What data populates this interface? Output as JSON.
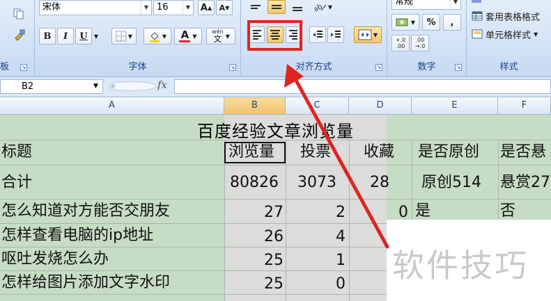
{
  "ribbon": {
    "font_group": {
      "font_name": "宋体",
      "font_size": "16",
      "label": "字体",
      "grow_label": "A",
      "shrink_label": "A",
      "bold": "B",
      "italic": "I",
      "underline": "U",
      "font_color_label": "A",
      "phonetic_label": "wén",
      "phonetic_char": "文"
    },
    "clipboard_group": {
      "label": "板"
    },
    "alignment_group": {
      "label": "对齐方式"
    },
    "number_group": {
      "label": "数字",
      "format_value": "常规",
      "percent": "%",
      "comma": ",",
      "inc_decimal": "+.0 .00",
      "dec_decimal": ".00 →.0"
    },
    "styles_group": {
      "label": "样式",
      "table_format": "套用表格格式",
      "cell_styles": "单元格样式"
    }
  },
  "formula_bar": {
    "name_box": "B2",
    "fx": "fx",
    "value": ""
  },
  "grid": {
    "columns": [
      "A",
      "B",
      "C",
      "D",
      "E",
      "F"
    ],
    "selected_column": "B",
    "title": "百度经验文章浏览量",
    "header_row": [
      "标题",
      "浏览量",
      "投票",
      "收藏",
      "是否原创",
      "是否悬"
    ],
    "total_row": [
      "合计",
      "80826",
      "3073",
      "28",
      "原创514",
      "悬赏27"
    ],
    "rows": [
      [
        "怎么知道对方能否交朋友",
        "27",
        "2",
        "0",
        "是",
        "否"
      ],
      [
        "怎样查看电脑的ip地址",
        "26",
        "4",
        "",
        "",
        ""
      ],
      [
        "呕吐发烧怎么办",
        "25",
        "1",
        "",
        "",
        ""
      ],
      [
        "怎样给图片添加文字水印",
        "25",
        "0",
        "",
        "",
        ""
      ]
    ]
  },
  "watermark": "软件技巧",
  "colors": {
    "highlight": "#e0241f",
    "arrow": "#e0241f",
    "sheet_fill": "#c7dcc4",
    "ribbon_label": "#15428b"
  }
}
